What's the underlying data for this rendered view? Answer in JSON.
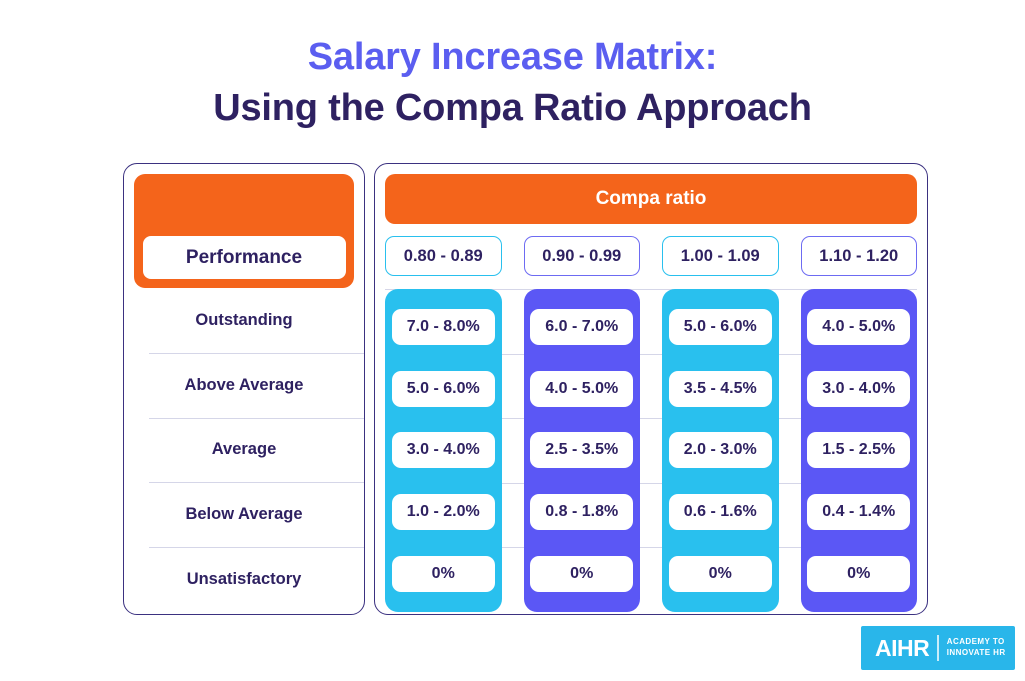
{
  "title": {
    "line1": "Salary Increase Matrix:",
    "line2": "Using the Compa Ratio Approach",
    "line1_color": "#5b5ef0",
    "line2_color": "#2e2161"
  },
  "matrix": {
    "row_header_title": "Performance",
    "column_group_title": "Compa ratio",
    "column_headers": [
      {
        "label": "0.80 - 0.89",
        "color": "#29c0ee"
      },
      {
        "label": "0.90 - 0.99",
        "color": "#5b57f5"
      },
      {
        "label": "1.00 - 1.09",
        "color": "#29c0ee"
      },
      {
        "label": "1.10 - 1.20",
        "color": "#5b57f5"
      }
    ],
    "row_headers": [
      "Outstanding",
      "Above Average",
      "Average",
      "Below Average",
      "Unsatisfactory"
    ],
    "columns": [
      {
        "color": "#29c0ee",
        "values": [
          "7.0 - 8.0%",
          "5.0 - 6.0%",
          "3.0 - 4.0%",
          "1.0 - 2.0%",
          "0%"
        ]
      },
      {
        "color": "#5b57f5",
        "values": [
          "6.0 - 7.0%",
          "4.0 - 5.0%",
          "2.5 - 3.5%",
          "0.8 - 1.8%",
          "0%"
        ]
      },
      {
        "color": "#29c0ee",
        "values": [
          "5.0 - 6.0%",
          "3.5 - 4.5%",
          "2.0 - 3.0%",
          "0.6 - 1.6%",
          "0%"
        ]
      },
      {
        "color": "#5b57f5",
        "values": [
          "4.0 - 5.0%",
          "3.0 - 4.0%",
          "1.5 - 2.5%",
          "0.4 - 1.4%",
          "0%"
        ]
      }
    ],
    "accent_orange": "#f4641b",
    "text_color": "#2e2161",
    "border_color": "#3b3180"
  },
  "logo": {
    "mark": "AIHR",
    "tagline_line1": "ACADEMY TO",
    "tagline_line2": "INNOVATE HR",
    "background": "#29b6ea"
  },
  "chart_data": {
    "type": "table",
    "title": "Salary Increase Matrix: Using the Compa Ratio Approach",
    "xlabel": "Compa ratio",
    "ylabel": "Performance",
    "categories": [
      "0.80 - 0.89",
      "0.90 - 0.99",
      "1.00 - 1.09",
      "1.10 - 1.20"
    ],
    "rows": [
      "Outstanding",
      "Above Average",
      "Average",
      "Below Average",
      "Unsatisfactory"
    ],
    "cells": [
      [
        "7.0 - 8.0%",
        "6.0 - 7.0%",
        "5.0 - 6.0%",
        "4.0 - 5.0%"
      ],
      [
        "5.0 - 6.0%",
        "4.0 - 5.0%",
        "3.5 - 4.5%",
        "3.0 - 4.0%"
      ],
      [
        "3.0 - 4.0%",
        "2.5 - 3.5%",
        "2.0 - 3.0%",
        "1.5 - 2.5%"
      ],
      [
        "1.0 - 2.0%",
        "0.8 - 1.8%",
        "0.6 - 1.6%",
        "0.4 - 1.4%"
      ],
      [
        "0%",
        "0%",
        "0%",
        "0%"
      ]
    ],
    "grid": true,
    "legend": "none"
  }
}
